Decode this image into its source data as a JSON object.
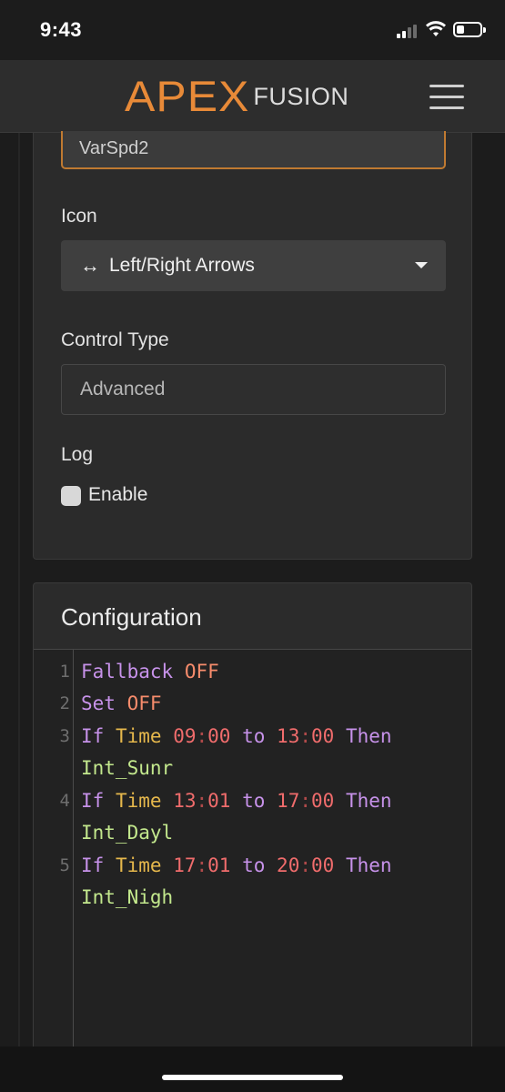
{
  "status": {
    "time": "9:43"
  },
  "header": {
    "logo_primary": "APEX",
    "logo_secondary": "FUSION"
  },
  "form": {
    "name_value": "VarSpd2",
    "icon_label": "Icon",
    "icon_glyph": "↔",
    "icon_value": "Left/Right Arrows",
    "control_type_label": "Control Type",
    "control_type_value": "Advanced",
    "log_label": "Log",
    "enable_label": "Enable",
    "enable_checked": false
  },
  "configuration": {
    "title": "Configuration",
    "line_numbers": [
      "1",
      "2",
      "3",
      "4",
      "5"
    ],
    "lines": [
      {
        "kw": "Fallback",
        "val": "OFF"
      },
      {
        "kw": "Set",
        "val": "OFF"
      },
      {
        "kw": "If",
        "fn": "Time",
        "start_h": "09",
        "start_m": "00",
        "to": "to",
        "end_h": "13",
        "end_m": "00",
        "then": "Then",
        "target": "Int_Sunr"
      },
      {
        "kw": "If",
        "fn": "Time",
        "start_h": "13",
        "start_m": "01",
        "to": "to",
        "end_h": "17",
        "end_m": "00",
        "then": "Then",
        "target": "Int_Dayl"
      },
      {
        "kw": "If",
        "fn": "Time",
        "start_h": "17",
        "start_m": "01",
        "to": "to",
        "end_h": "20",
        "end_m": "00",
        "then": "Then",
        "target": "Int_Nigh"
      }
    ]
  },
  "colors": {
    "accent": "#e88a38",
    "keyword": "#c792ea",
    "value": "#f78c6c",
    "function": "#e6b84c",
    "number": "#f06c6c",
    "identifier": "#c3e88d"
  }
}
